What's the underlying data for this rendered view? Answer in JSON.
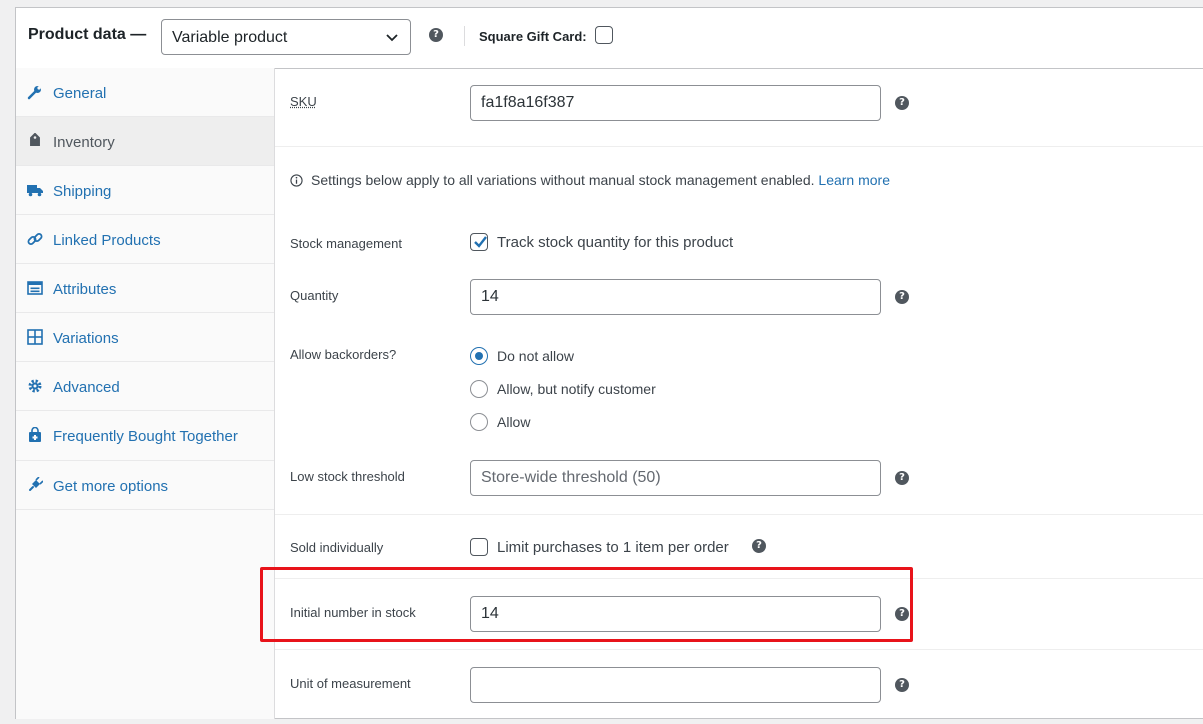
{
  "header": {
    "title": "Product data —",
    "product_type": "Variable product",
    "gift_card_label": "Square Gift Card:"
  },
  "sidebar": {
    "tabs": [
      {
        "label": "General",
        "icon": "wrench-icon"
      },
      {
        "label": "Inventory",
        "icon": "tag-icon",
        "active": true
      },
      {
        "label": "Shipping",
        "icon": "truck-icon"
      },
      {
        "label": "Linked Products",
        "icon": "link-icon"
      },
      {
        "label": "Attributes",
        "icon": "list-icon"
      },
      {
        "label": "Variations",
        "icon": "grid-icon"
      },
      {
        "label": "Advanced",
        "icon": "gear-icon"
      },
      {
        "label": "Frequently Bought Together",
        "icon": "bag-icon"
      },
      {
        "label": "Get more options",
        "icon": "plugin-icon"
      }
    ]
  },
  "inventory": {
    "sku_label": "SKU",
    "sku_value": "fa1f8a16f387",
    "info_text": "Settings below apply to all variations without manual stock management enabled.",
    "info_link": "Learn more",
    "stock_management_label": "Stock management",
    "stock_management_option": "Track stock quantity for this product",
    "stock_management_checked": true,
    "quantity_label": "Quantity",
    "quantity_value": "14",
    "backorders_label": "Allow backorders?",
    "backorder_options": [
      "Do not allow",
      "Allow, but notify customer",
      "Allow"
    ],
    "backorder_selected": "Do not allow",
    "low_stock_label": "Low stock threshold",
    "low_stock_placeholder": "Store-wide threshold (50)",
    "sold_individually_label": "Sold individually",
    "sold_individually_option": "Limit purchases to 1 item per order",
    "sold_individually_checked": false,
    "initial_stock_label": "Initial number in stock",
    "initial_stock_value": "14",
    "unit_label": "Unit of measurement",
    "unit_value": ""
  },
  "colors": {
    "link": "#2271b1",
    "highlight": "#e8131a",
    "text": "#3c434a"
  }
}
